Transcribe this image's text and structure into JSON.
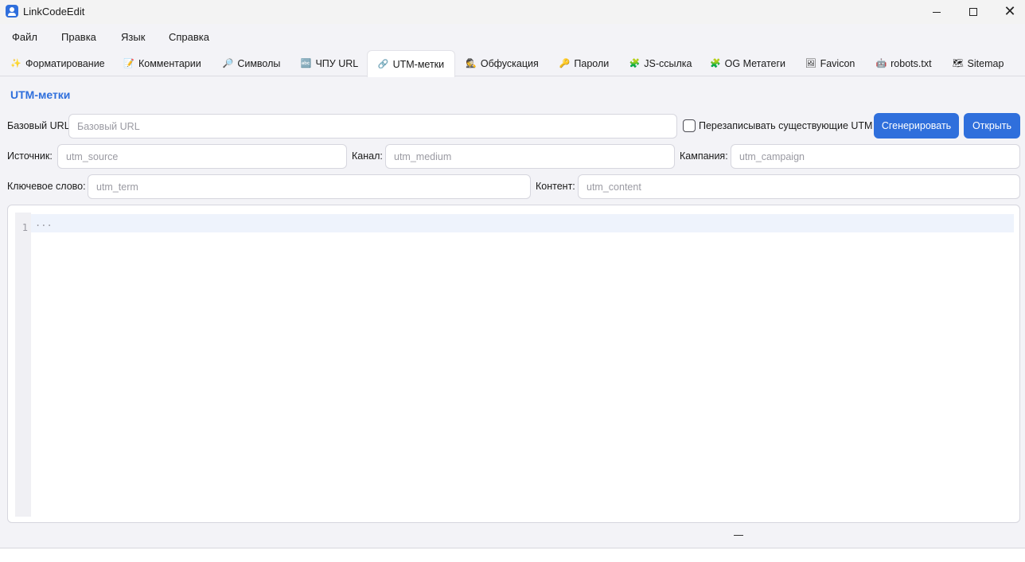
{
  "window": {
    "title": "LinkCodeEdit"
  },
  "menu": [
    "Файл",
    "Правка",
    "Язык",
    "Справка"
  ],
  "tabs": [
    {
      "icon": "✨",
      "label": "Форматирование"
    },
    {
      "icon": "📝",
      "label": "Комментарии"
    },
    {
      "icon": "🔎",
      "label": "Символы"
    },
    {
      "icon": "🔤",
      "label": "ЧПУ URL"
    },
    {
      "icon": "🔗",
      "label": "UTM-метки"
    },
    {
      "icon": "🕵",
      "label": "Обфускация"
    },
    {
      "icon": "🔑",
      "label": "Пароли"
    },
    {
      "icon": "🧩",
      "label": "JS-ссылка"
    },
    {
      "icon": "🧩",
      "label": "OG Метатеги"
    },
    {
      "icon": "🖼",
      "label": "Favicon"
    },
    {
      "icon": "🤖",
      "label": "robots.txt"
    },
    {
      "icon": "🗺",
      "label": "Sitemap"
    }
  ],
  "active_tab": "UTM-метки",
  "section_title": "UTM-метки",
  "form": {
    "base_url": {
      "label": "Базовый URL",
      "placeholder": "Базовый URL",
      "value": ""
    },
    "overwrite_label": "Перезаписывать существующие UTM",
    "overwrite_checked": false,
    "generate_label": "Сгенерировать",
    "open_label": "Открыть",
    "source": {
      "label": "Источник:",
      "placeholder": "utm_source",
      "value": ""
    },
    "medium": {
      "label": "Канал:",
      "placeholder": "utm_medium",
      "value": ""
    },
    "campaign": {
      "label": "Кампания:",
      "placeholder": "utm_campaign",
      "value": ""
    },
    "term": {
      "label": "Ключевое слово:",
      "placeholder": "utm_term",
      "value": ""
    },
    "content": {
      "label": "Контент:",
      "placeholder": "utm_content",
      "value": ""
    }
  },
  "editor": {
    "line_number": "1",
    "placeholder_text": "..."
  },
  "colors": {
    "accent": "#2f6fdc",
    "background": "#f3f3f7",
    "active_line": "#eef3fc"
  }
}
